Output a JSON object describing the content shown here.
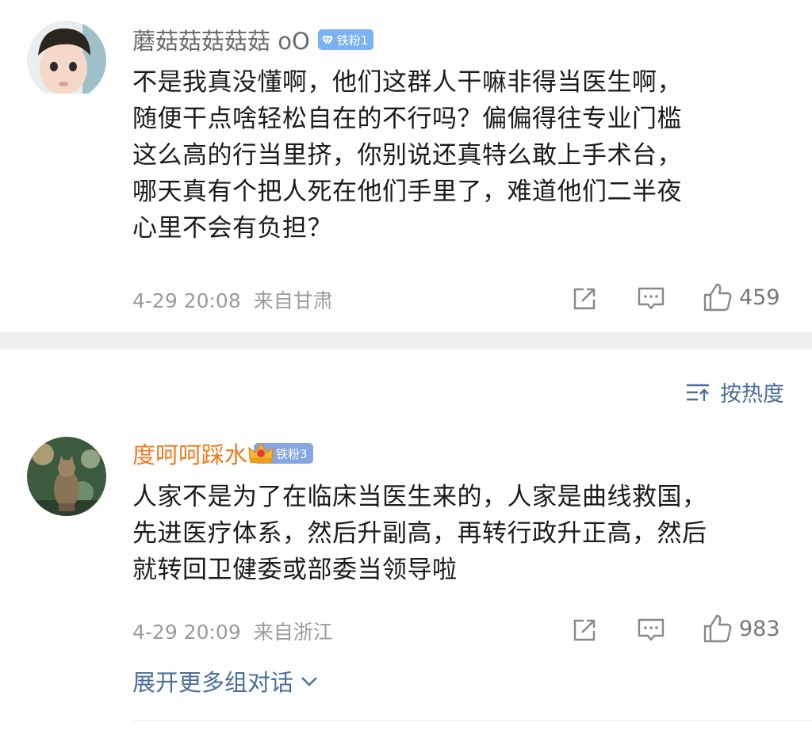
{
  "comments": [
    {
      "username": "蘑菇菇菇菇菇 oO",
      "badge": "铁粉1",
      "text": "不是我真没懂啊，他们这群人干嘛非得当医生啊，\n随便干点啥轻松自在的不行吗？偏偏得往专业门槛\n这么高的行当里挤，你别说还真特么敢上手术台，\n哪天真有个把人死在他们手里了，难道他们二半夜\n心里不会有负担？",
      "time": "4-29 20:08",
      "location": "来自甘肃",
      "likes": "459",
      "icons": {
        "share": "share-icon",
        "comment": "comment-icon",
        "like": "thumbs-up-icon"
      }
    },
    {
      "username": "度呵呵踩水",
      "badge": "铁粉3",
      "text": "人家不是为了在临床当医生来的，人家是曲线救国，\n先进医疗体系，然后升副高，再转行政升正高，然后\n就转回卫健委或部委当领导啦",
      "time": "4-29 20:09",
      "location": "来自浙江",
      "likes": "983",
      "icons": {
        "share": "share-icon",
        "comment": "comment-icon",
        "like": "thumbs-up-icon"
      }
    }
  ],
  "sort": {
    "label": "按热度",
    "icon": "sort-icon"
  },
  "expand": {
    "label": "展开更多组对话",
    "icon": "chevron-down-icon"
  },
  "colors": {
    "link": "#4a6e9b",
    "username_orange": "#f07a1e",
    "username_gray": "#6b6b6b",
    "meta_gray": "#9b9b9b",
    "badge_blue": "#7ab2f3",
    "divider": "#f0f0f0"
  }
}
